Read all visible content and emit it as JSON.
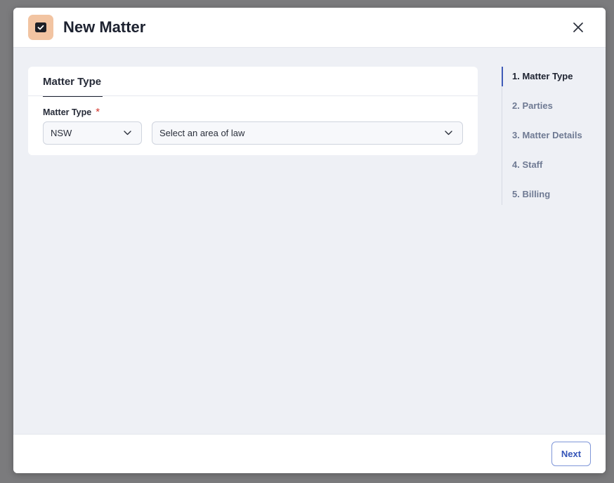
{
  "header": {
    "title": "New Matter",
    "app_icon": "folder-check-icon",
    "close_icon": "close-icon"
  },
  "card": {
    "tab_label": "Matter Type",
    "field_label": "Matter Type",
    "required_marker": "*",
    "state_select": {
      "value": "NSW"
    },
    "area_select": {
      "placeholder": "Select an area of law"
    }
  },
  "steps": [
    {
      "label": "1. Matter Type",
      "active": true
    },
    {
      "label": "2. Parties",
      "active": false
    },
    {
      "label": "3. Matter Details",
      "active": false
    },
    {
      "label": "4. Staff",
      "active": false
    },
    {
      "label": "5. Billing",
      "active": false
    }
  ],
  "footer": {
    "next_label": "Next"
  },
  "colors": {
    "accent": "#3f5bb8",
    "icon_bg": "#f2c4a2",
    "required": "#d3362d"
  }
}
